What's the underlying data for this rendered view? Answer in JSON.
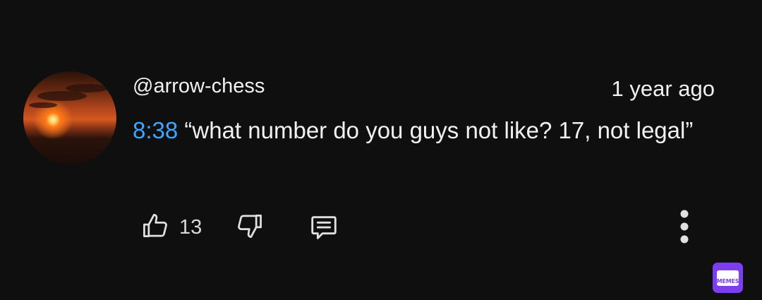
{
  "comment": {
    "author": "@arrow-chess",
    "timestamp": "1 year ago",
    "time_link": "8:38",
    "text": " “what number do you guys not like? 17, not legal”",
    "like_count": "13"
  },
  "icons": {
    "like": "thumbs-up-icon",
    "dislike": "thumbs-down-icon",
    "reply": "comment-icon",
    "more": "more-vertical-icon"
  },
  "watermark": {
    "text": "MEMES"
  },
  "colors": {
    "background": "#0f0f0f",
    "text": "#f1f1f1",
    "link": "#3ea6ff",
    "icon": "#e0e0e0",
    "brand": "#7c3ef0"
  }
}
